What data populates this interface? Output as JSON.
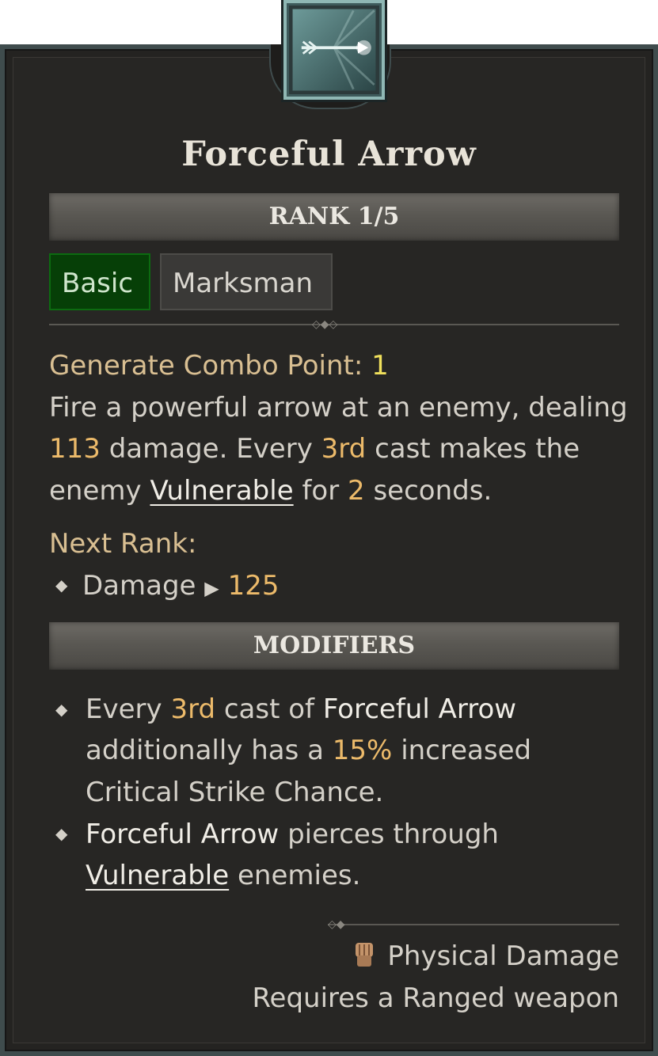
{
  "skill": {
    "name": "Forceful Arrow",
    "rank_label": "RANK 1/5",
    "tags": [
      "Basic",
      "Marksman"
    ]
  },
  "description": {
    "generate_label": "Generate Combo Point:",
    "generate_value": "1",
    "line1": "Fire a powerful arrow at an enemy, dealing",
    "damage_value": "113",
    "line2_mid": "damage. Every",
    "every_value": "3rd",
    "line2_end": "cast makes the",
    "line3_start": "enemy",
    "vulnerable_link": "Vulnerable",
    "line3_mid": "for",
    "seconds_value": "2",
    "line3_end": "seconds."
  },
  "next_rank": {
    "label": "Next Rank:",
    "stat_label": "Damage",
    "stat_arrow": "▶",
    "stat_value": "125"
  },
  "modifiers": {
    "header": "MODIFIERS",
    "items": [
      {
        "pre": "Every",
        "highlight": "3rd",
        "mid": "cast of",
        "skill_ref": "Forceful Arrow",
        "line2_pre": "additionally has a",
        "line2_value": "15%",
        "line2_end": "increased",
        "line3": "Critical Strike Chance."
      },
      {
        "skill_ref": "Forceful Arrow",
        "rest": "pierces through",
        "link": "Vulnerable",
        "end": "enemies."
      }
    ]
  },
  "footer": {
    "damage_type": "Physical Damage",
    "damage_icon": "fist-icon",
    "requirement": "Requires a Ranged weapon"
  },
  "colors": {
    "background": "#272624",
    "basic_tag": "#063f07",
    "highlight_gold": "#ecba6a",
    "highlight_yellow": "#f0e05c",
    "label_beige": "#d9bf92"
  }
}
